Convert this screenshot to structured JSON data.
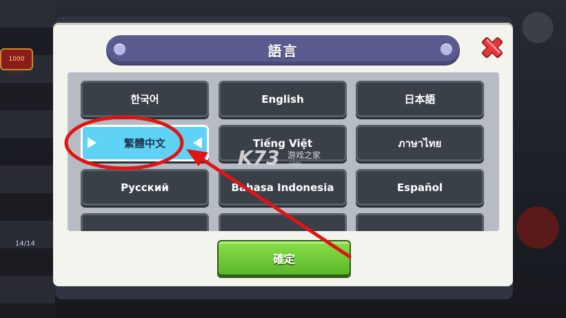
{
  "background": {
    "badge_text": "1000",
    "level_text": "14/14"
  },
  "dialog": {
    "title": "語言",
    "confirm_label": "確定"
  },
  "languages": [
    {
      "label": "한국어",
      "selected": false
    },
    {
      "label": "English",
      "selected": false
    },
    {
      "label": "日本語",
      "selected": false
    },
    {
      "label": "繁體中文",
      "selected": true
    },
    {
      "label": "Tiếng Việt",
      "selected": false
    },
    {
      "label": "ภาษาไทย",
      "selected": false
    },
    {
      "label": "Русский",
      "selected": false
    },
    {
      "label": "Bahasa Indonesia",
      "selected": false
    },
    {
      "label": "Español",
      "selected": false
    }
  ],
  "watermark": {
    "logo": "K73",
    "text": "游戏之家",
    "url": ".com"
  },
  "colors": {
    "title_bar": "#5a5a8e",
    "button_dark": "#3a4048",
    "selected": "#5fd2f5",
    "confirm_green": "#6fcb36",
    "annotation_red": "#e11414",
    "close_red": "#e23a3a"
  },
  "icons": {
    "close": "close-x-icon",
    "selection": "triangle-arrow-icon"
  }
}
